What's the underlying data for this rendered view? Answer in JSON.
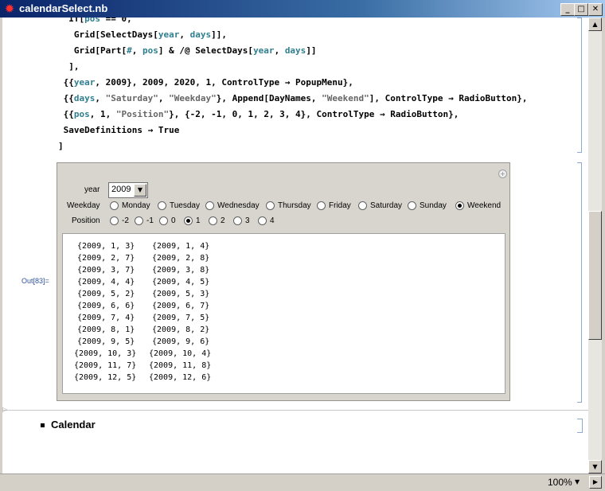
{
  "window": {
    "title": "calendarSelect.nb",
    "min": "_",
    "max": "□",
    "close": "✕"
  },
  "code_lines": [
    {
      "parts": [
        {
          "t": "  If[",
          "c": ""
        },
        {
          "t": "pos",
          "c": "teal"
        },
        {
          "t": " == 0,",
          "c": ""
        }
      ]
    },
    {
      "parts": [
        {
          "t": "   Grid[SelectDays[",
          "c": ""
        },
        {
          "t": "year",
          "c": "teal"
        },
        {
          "t": ", ",
          "c": ""
        },
        {
          "t": "days",
          "c": "teal"
        },
        {
          "t": "]],",
          "c": ""
        }
      ]
    },
    {
      "parts": [
        {
          "t": "   Grid[Part[",
          "c": ""
        },
        {
          "t": "#",
          "c": "teal"
        },
        {
          "t": ", ",
          "c": ""
        },
        {
          "t": "pos",
          "c": "teal"
        },
        {
          "t": "] & /@ SelectDays[",
          "c": ""
        },
        {
          "t": "year",
          "c": "teal"
        },
        {
          "t": ", ",
          "c": ""
        },
        {
          "t": "days",
          "c": "teal"
        },
        {
          "t": "]]",
          "c": ""
        }
      ]
    },
    {
      "parts": [
        {
          "t": "  ],",
          "c": ""
        }
      ]
    },
    {
      "parts": [
        {
          "t": " {{",
          "c": ""
        },
        {
          "t": "year",
          "c": "teal"
        },
        {
          "t": ", 2009}, 2009, 2020, 1, ControlType → PopupMenu},",
          "c": ""
        }
      ]
    },
    {
      "parts": [
        {
          "t": " {{",
          "c": ""
        },
        {
          "t": "days",
          "c": "teal"
        },
        {
          "t": ", ",
          "c": ""
        },
        {
          "t": "\"Saturday\"",
          "c": "gray"
        },
        {
          "t": ", ",
          "c": ""
        },
        {
          "t": "\"Weekday\"",
          "c": "gray"
        },
        {
          "t": "}, Append[DayNames, ",
          "c": ""
        },
        {
          "t": "\"Weekend\"",
          "c": "gray"
        },
        {
          "t": "], ControlType → RadioButton},",
          "c": ""
        }
      ]
    },
    {
      "parts": [
        {
          "t": " {{",
          "c": ""
        },
        {
          "t": "pos",
          "c": "teal"
        },
        {
          "t": ", 1, ",
          "c": ""
        },
        {
          "t": "\"Position\"",
          "c": "gray"
        },
        {
          "t": "}, {-2, -1, 0, 1, 2, 3, 4}, ControlType → RadioButton},",
          "c": ""
        }
      ]
    },
    {
      "parts": [
        {
          "t": " SaveDefinitions → True",
          "c": ""
        }
      ]
    },
    {
      "parts": [
        {
          "t": "]",
          "c": ""
        }
      ]
    }
  ],
  "output_label": "Out[83]=",
  "manipulate": {
    "year_label": "year",
    "year_value": "2009",
    "weekday_label": "Weekday",
    "day_options": [
      "Monday",
      "Tuesday",
      "Wednesday",
      "Thursday",
      "Friday",
      "Saturday",
      "Sunday",
      "Weekend"
    ],
    "day_selected": "Weekend",
    "position_label": "Position",
    "position_options": [
      "-2",
      "-1",
      "0",
      "1",
      "2",
      "3",
      "4"
    ],
    "position_selected": "1",
    "results": [
      [
        "{2009, 1, 3}",
        "{2009, 1, 4}"
      ],
      [
        "{2009, 2, 7}",
        "{2009, 2, 8}"
      ],
      [
        "{2009, 3, 7}",
        "{2009, 3, 8}"
      ],
      [
        "{2009, 4, 4}",
        "{2009, 4, 5}"
      ],
      [
        "{2009, 5, 2}",
        "{2009, 5, 3}"
      ],
      [
        "{2009, 6, 6}",
        "{2009, 6, 7}"
      ],
      [
        "{2009, 7, 4}",
        "{2009, 7, 5}"
      ],
      [
        "{2009, 8, 1}",
        "{2009, 8, 2}"
      ],
      [
        "{2009, 9, 5}",
        "{2009, 9, 6}"
      ],
      [
        "{2009, 10, 3}",
        "{2009, 10, 4}"
      ],
      [
        "{2009, 11, 7}",
        "{2009, 11, 8}"
      ],
      [
        "{2009, 12, 5}",
        "{2009, 12, 6}"
      ]
    ]
  },
  "section_title": "Calendar",
  "status": {
    "zoom": "100%"
  }
}
